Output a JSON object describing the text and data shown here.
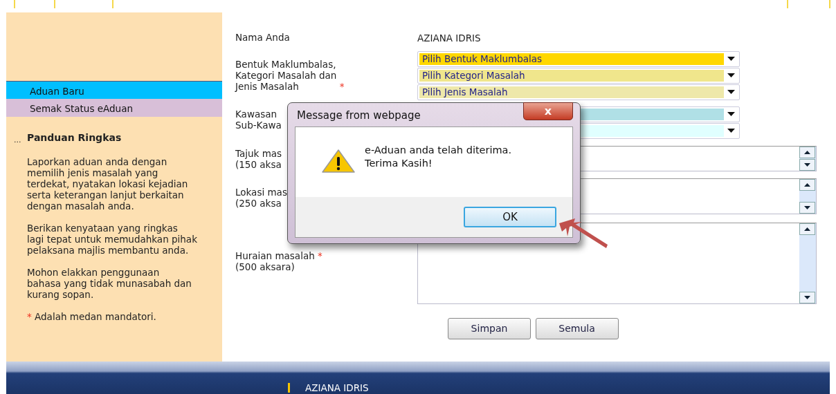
{
  "sidebar": {
    "menu": [
      {
        "label": "Aduan Baru",
        "selected": true
      },
      {
        "label": "Semak Status eAduan",
        "selected": false
      }
    ],
    "marker": "...",
    "guide_title": "Panduan Ringkas",
    "paragraphs": [
      "Laporkan aduan anda dengan\nmemilih jenis masalah yang\nterdekat, nyatakan lokasi kejadian\nserta keterangan lanjut berkaitan\ndengan masalah anda.",
      "Berikan kenyataan yang ringkas\nlagi tepat untuk memudahkan pihak\npelaksana majlis membantu anda.",
      "Mohon elakkan penggunaan\nbahasa yang tidak munasabah dan\nkurang sopan."
    ],
    "note": {
      "mark": "*",
      "text": "Adalah medan mandatori."
    }
  },
  "form": {
    "rows": [
      {
        "kind": "value",
        "label": "Nama Anda",
        "value": "AZIANA IDRIS"
      },
      {
        "kind": "selects",
        "label": "Bentuk Maklumbalas,\nKategori Masalah dan\nJenis Masalah",
        "required_mark": "*",
        "selects": [
          {
            "text": "Pilih Bentuk Maklumbalas",
            "color": "#ffd700"
          },
          {
            "text": "Pilih Kategori Masalah",
            "color": "#f0e68c"
          },
          {
            "text": "Pilih Jenis Masalah",
            "color": "#eee8aa"
          }
        ]
      },
      {
        "kind": "selects",
        "label": "Kawasan\nSub-Kawa",
        "selects": [
          {
            "color": "#b0e0e6"
          },
          {
            "color": "#e0ffff"
          }
        ]
      },
      {
        "kind": "textarea",
        "label": "Tajuk mas\n(150 aksa"
      },
      {
        "kind": "textarea",
        "label": "Lokasi mas\n(250 aksa"
      },
      {
        "kind": "textarea",
        "label": "Huraian masalah",
        "required_mark": "*",
        "note": "(500 aksara)"
      }
    ],
    "buttons": [
      "Simpan",
      "Semula"
    ]
  },
  "footer": {
    "user": "AZIANA IDRIS"
  },
  "dialog": {
    "title": "Message from webpage",
    "close": "x",
    "message": "e-Aduan anda telah diterima.\nTerima Kasih!",
    "button": "OK"
  }
}
